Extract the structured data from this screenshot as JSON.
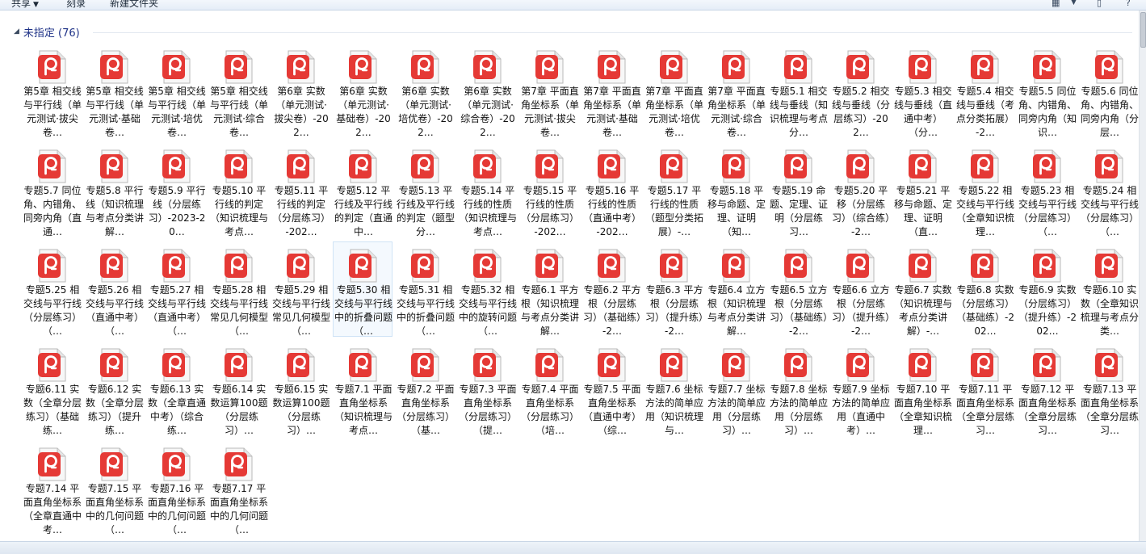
{
  "toolbar": {
    "share_label": "共享",
    "burn_label": "刻录",
    "new_folder_label": "新建文件夹"
  },
  "group": {
    "title": "未指定 (76)"
  },
  "icon_colors": {
    "accent": "#e53935",
    "page": "#f7f7f7"
  },
  "files": [
    "第5章 相交线与平行线（单元测试·拔尖卷…",
    "第5章 相交线与平行线（单元测试·基础卷…",
    "第5章 相交线与平行线（单元测试·培优卷…",
    "第5章 相交线与平行线（单元测试·综合卷…",
    "第6章 实数（单元测试·拔尖卷）-202…",
    "第6章 实数（单元测试·基础卷）-202…",
    "第6章 实数（单元测试·培优卷）-202…",
    "第6章 实数（单元测试·综合卷）-202…",
    "第7章 平面直角坐标系（单元测试·拔尖卷…",
    "第7章 平面直角坐标系（单元测试·基础卷…",
    "第7章 平面直角坐标系（单元测试·培优卷…",
    "第7章 平面直角坐标系（单元测试·综合卷…",
    "专题5.1 相交线与垂线（知识梳理与考点分…",
    "专题5.2 相交线与垂线（分层练习）-202…",
    "专题5.3 相交线与垂线（直通中考）（分…",
    "专题5.4 相交线与垂线（考点分类拓展）-2…",
    "专题5.5 同位角、内错角、同旁内角（知识…",
    "专题5.6 同位角、内错角、同旁内角（分层…",
    "专题5.7 同位角、内错角、同旁内角（直通…",
    "专题5.8 平行线（知识梳理与考点分类讲解…",
    "专题5.9 平行线（分层练习）-2023-20…",
    "专题5.10 平行线的判定（知识梳理与考点…",
    "专题5.11 平行线的判定（分层练习）-202…",
    "专题5.12 平行线及平行线的判定（直通中…",
    "专题5.13 平行线及平行线的判定（题型分…",
    "专题5.14 平行线的性质（知识梳理与考点…",
    "专题5.15 平行线的性质（分层练习）-202…",
    "专题5.16 平行线的性质（直通中考）-202…",
    "专题5.17 平行线的性质（题型分类拓展）-…",
    "专题5.18 平移与命题、定理、证明（知…",
    "专题5.19 命题、定理、证明（分层练习…",
    "专题5.20 平移（分层练习）（综合练）-2…",
    "专题5.21 平移与命题、定理、证明（直…",
    "专题5.22 相交线与平行线（全章知识梳理…",
    "专题5.23 相交线与平行线（分层练习）（…",
    "专题5.24 相交线与平行线（分层练习）（…",
    "专题5.25 相交线与平行线（分层练习）（…",
    "专题5.26 相交线与平行线（直通中考）（…",
    "专题5.27 相交线与平行线（直通中考）（…",
    "专题5.28 相交线与平行线常见几何模型（…",
    "专题5.29 相交线与平行线常见几何模型（…",
    "专题5.30 相交线与平行线中的折叠问题（…",
    "专题5.31 相交线与平行线中的折叠问题（…",
    "专题5.32 相交线与平行线中的旋转问题（…",
    "专题6.1 平方根（知识梳理与考点分类讲解…",
    "专题6.2 平方根（分层练习）（基础练）-2…",
    "专题6.3 平方根（分层练习）（提升练）-2…",
    "专题6.4 立方根（知识梳理与考点分类讲解…",
    "专题6.5 立方根（分层练习）（基础练）-2…",
    "专题6.6 立方根（分层练习）（提升练）-2…",
    "专题6.7 实数（知识梳理与考点分类讲解）-…",
    "专题6.8 实数（分层练习）（基础练）-202…",
    "专题6.9 实数（分层练习）（提升练）-202…",
    "专题6.10 实数（全章知识梳理与考点分类…",
    "专题6.11 实数（全章分层练习）（基础练…",
    "专题6.12 实数（全章分层练习）（提升练…",
    "专题6.13 实数（全章直通中考）（综合练…",
    "专题6.14 实数运算100题（分层练习）…",
    "专题6.15 实数运算100题（分层练习）…",
    "专题7.1 平面直角坐标系（知识梳理与考点…",
    "专题7.2 平面直角坐标系（分层练习）（基…",
    "专题7.3 平面直角坐标系（分层练习）（提…",
    "专题7.4 平面直角坐标系（分层练习）（培…",
    "专题7.5 平面直角坐标系（直通中考）（综…",
    "专题7.6 坐标方法的简单应用（知识梳理与…",
    "专题7.7 坐标方法的简单应用（分层练习）…",
    "专题7.8 坐标方法的简单应用（分层练习）…",
    "专题7.9 坐标方法的简单应用（直通中考）…",
    "专题7.10 平面直角坐标系（全章知识梳理…",
    "专题7.11 平面直角坐标系（全章分层练习…",
    "专题7.12 平面直角坐标系（全章分层练习…",
    "专题7.13 平面直角坐标系（全章分层练习…",
    "专题7.14 平面直角坐标系（全章直通中考…",
    "专题7.15 平面直角坐标系中的几何问题（…",
    "专题7.16 平面直角坐标系中的几何问题（…",
    "专题7.17 平面直角坐标系中的几何问题（…"
  ]
}
